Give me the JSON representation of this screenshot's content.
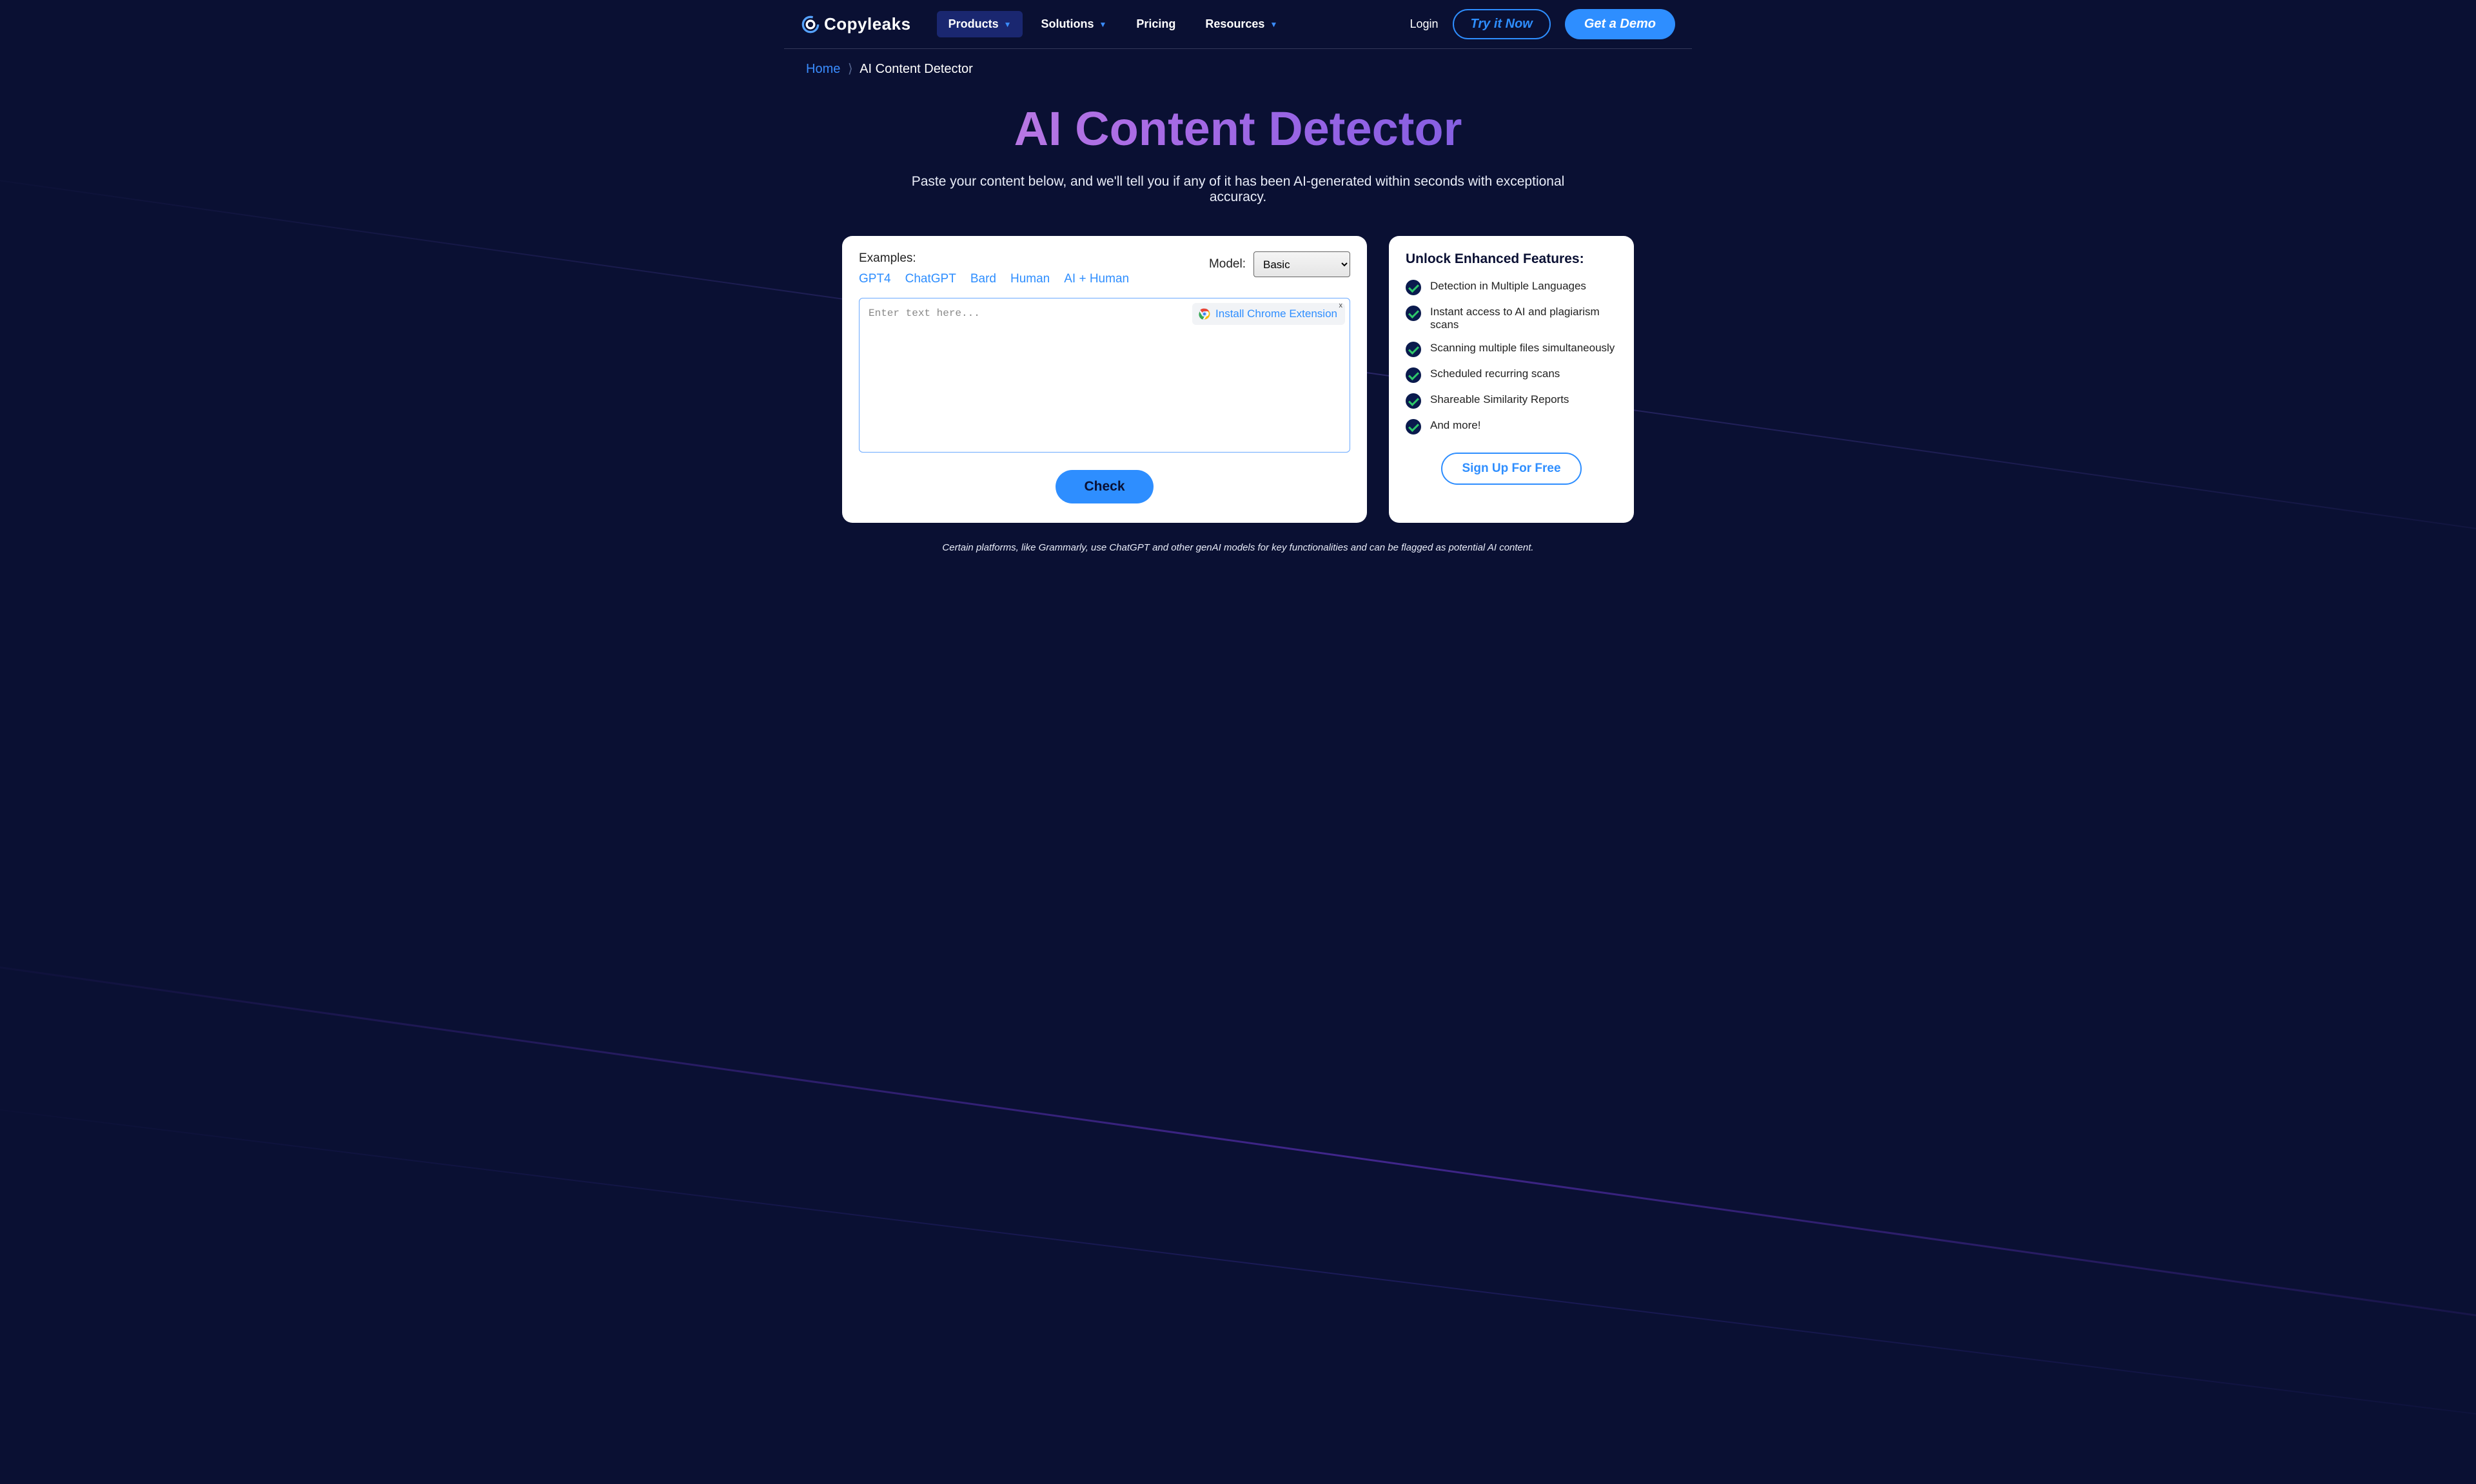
{
  "brand": {
    "name": "Copyleaks"
  },
  "nav": {
    "items": [
      {
        "label": "Products",
        "active": true,
        "has_caret": true
      },
      {
        "label": "Solutions",
        "active": false,
        "has_caret": true
      },
      {
        "label": "Pricing",
        "active": false,
        "has_caret": false
      },
      {
        "label": "Resources",
        "active": false,
        "has_caret": true
      }
    ],
    "login": "Login",
    "try": "Try it Now",
    "demo": "Get a Demo"
  },
  "breadcrumb": {
    "home": "Home",
    "sep": "⟩",
    "current": "AI Content Detector"
  },
  "hero": {
    "title": "AI Content Detector",
    "subtitle": "Paste your content below, and we'll tell you if any of it has been AI-generated within seconds with exceptional accuracy."
  },
  "detector": {
    "examples_label": "Examples:",
    "examples": [
      "GPT4",
      "ChatGPT",
      "Bard",
      "Human",
      "AI + Human"
    ],
    "model_label": "Model:",
    "model_selected": "Basic",
    "placeholder": "Enter text here...",
    "chrome_ext": "Install Chrome Extension",
    "chrome_close": "x",
    "check": "Check"
  },
  "unlock": {
    "title": "Unlock Enhanced Features:",
    "features": [
      "Detection in Multiple Languages",
      "Instant access to AI and plagiarism scans",
      "Scanning multiple files simultaneously",
      "Scheduled recurring scans",
      "Shareable Similarity Reports",
      "And more!"
    ],
    "signup": "Sign Up For Free"
  },
  "footnote": "Certain platforms, like Grammarly, use ChatGPT and other genAI models for key functionalities and can be flagged as potential AI content."
}
